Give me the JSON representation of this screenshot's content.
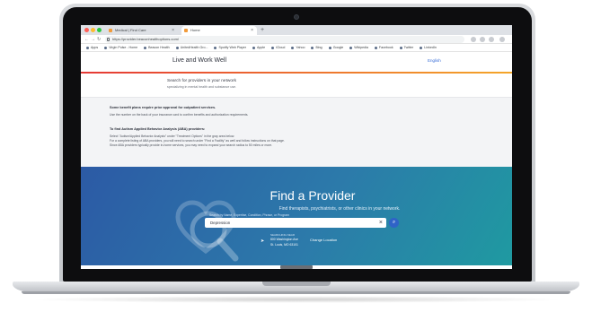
{
  "browser": {
    "tabs": [
      {
        "label": "Medical | Find Care"
      },
      {
        "label": "Home"
      }
    ],
    "url": "https://provider.beaconhealthoptions.com/",
    "bookmarks": [
      "Apps",
      "Virgin Pulse - Home",
      "Beacon Health",
      "UnitedHealth Gro...",
      "Spotify Web Player",
      "Apple",
      "iCloud",
      "Yahoo",
      "Bing",
      "Google",
      "Wikipedia",
      "Facebook",
      "Twitter",
      "LinkedIn"
    ]
  },
  "site": {
    "title": "Live and Work Well",
    "language": "English"
  },
  "intro": {
    "heading": "Search for providers in your network",
    "subheading": "specializing in mental health and substance use."
  },
  "notice": {
    "title": "Some benefit plans require prior approval for outpatient services.",
    "line1": "Use the number on the back of your insurance card to confirm benefits and authorization requirements.",
    "title2": "To find Autism Applied Behavior Analysis (ABA) providers:",
    "lines": [
      "Select \"Autism/Applied Behavior Analysis\" under \"Treatment Options\" in the gray area below.",
      "For a complete listing of ABA providers, you will need to search under \"Find a Facility\" as well and follow instructions on that page.",
      "Since ABA providers typically provide in-home services, you may need to expand your search radius to 50 miles or more."
    ]
  },
  "hero": {
    "title": "Find a Provider",
    "subtitle": "Find therapists, psychiatrists, or other clinics in your network.",
    "hint": "Search by Name, Expertise, Condition, Phrase, or Program",
    "search_value": "Depression",
    "clear_icon": "×",
    "search_icon": "⌕",
    "location_label": "SEARCHING NEAR",
    "address_line1": "800 Washington Ave",
    "address_line2": "St. Louis, MO 63101",
    "change_location": "Change Location"
  },
  "colors": {
    "accent_blue": "#2f63c7",
    "header_rule_start": "#e53935",
    "header_rule_end": "#f4a62a",
    "hero_start": "#2c5aa5",
    "hero_end": "#1f9aa1"
  }
}
